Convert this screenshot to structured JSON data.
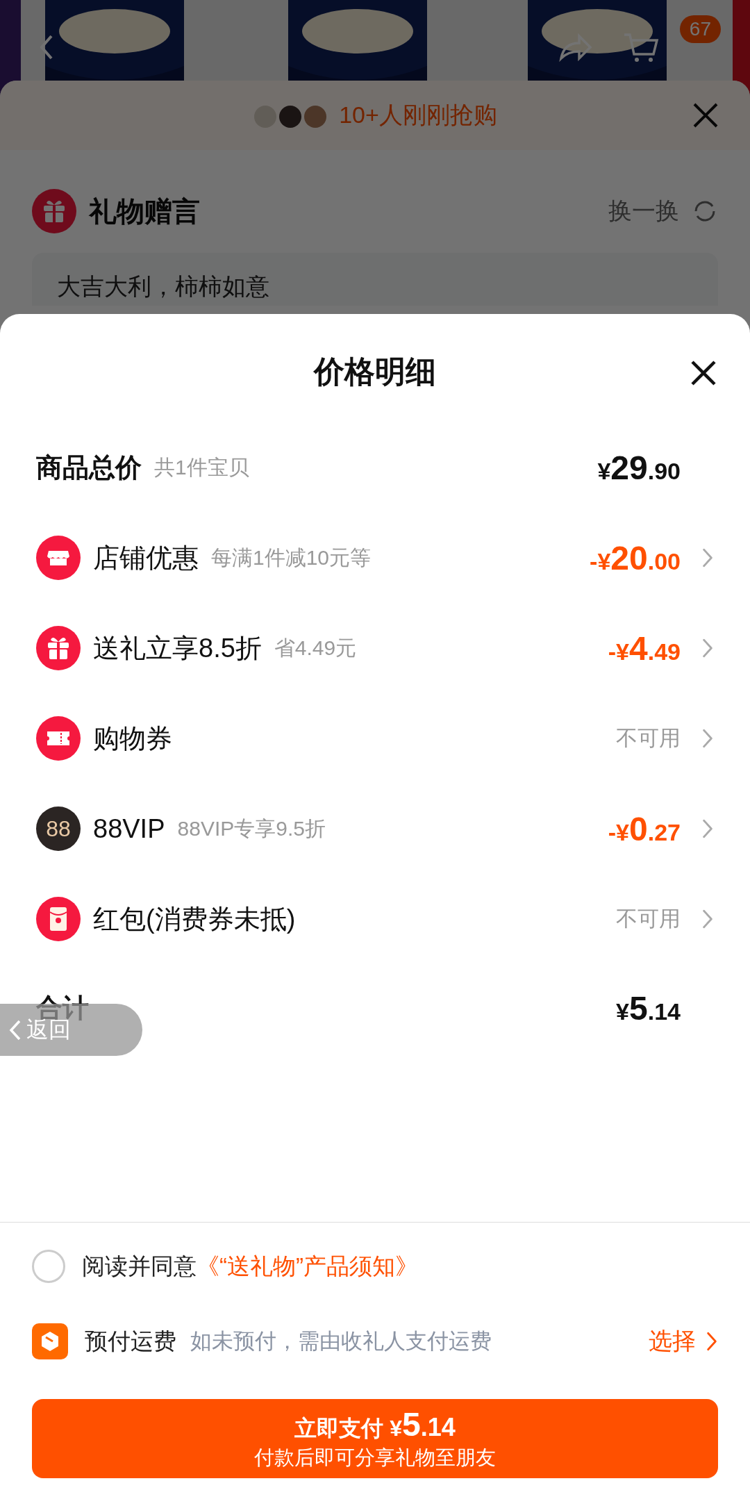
{
  "background": {
    "cart_badge": "67",
    "buyers_banner": "10+人刚刚抢购",
    "gift_message": {
      "title": "礼物赠言",
      "refresh": "换一换",
      "text": "大吉大利，柿柿如意"
    }
  },
  "sheet": {
    "title": "价格明细",
    "subtotal": {
      "label": "商品总价",
      "note": "共1件宝贝",
      "amount": {
        "prefix": "¥",
        "whole": "29",
        "fraction": ".90"
      }
    },
    "rows": [
      {
        "label": "店铺优惠",
        "note": "每满1件减10元等",
        "kind": "amount",
        "amount": {
          "prefix": "-¥",
          "whole": "20",
          "fraction": ".00"
        }
      },
      {
        "label": "送礼立享8.5折",
        "note": "省4.49元",
        "kind": "amount",
        "amount": {
          "prefix": "-¥",
          "whole": "4",
          "fraction": ".49"
        }
      },
      {
        "label": "购物券",
        "kind": "status",
        "status": "不可用"
      },
      {
        "icon_text": "88",
        "label": "88VIP",
        "note": "88VIP专享9.5折",
        "kind": "amount",
        "amount": {
          "prefix": "-¥",
          "whole": "0",
          "fraction": ".27"
        }
      },
      {
        "label": "红包(消费券未抵)",
        "kind": "status",
        "status": "不可用"
      }
    ],
    "total": {
      "label": "合计",
      "amount": {
        "prefix": "¥",
        "whole": "5",
        "fraction": ".14"
      }
    },
    "back_button": "返回",
    "agreement": {
      "checked": false,
      "text": "阅读并同意",
      "link": "《“送礼物”产品须知》"
    },
    "freight": {
      "label": "预付运费",
      "note": "如未预付，需由收礼人支付运费",
      "action": "选择"
    },
    "pay_button": {
      "label": "立即支付",
      "amount": {
        "prefix": "¥",
        "whole": "5",
        "fraction": ".14"
      },
      "subtitle": "付款后即可分享礼物至朋友"
    }
  }
}
